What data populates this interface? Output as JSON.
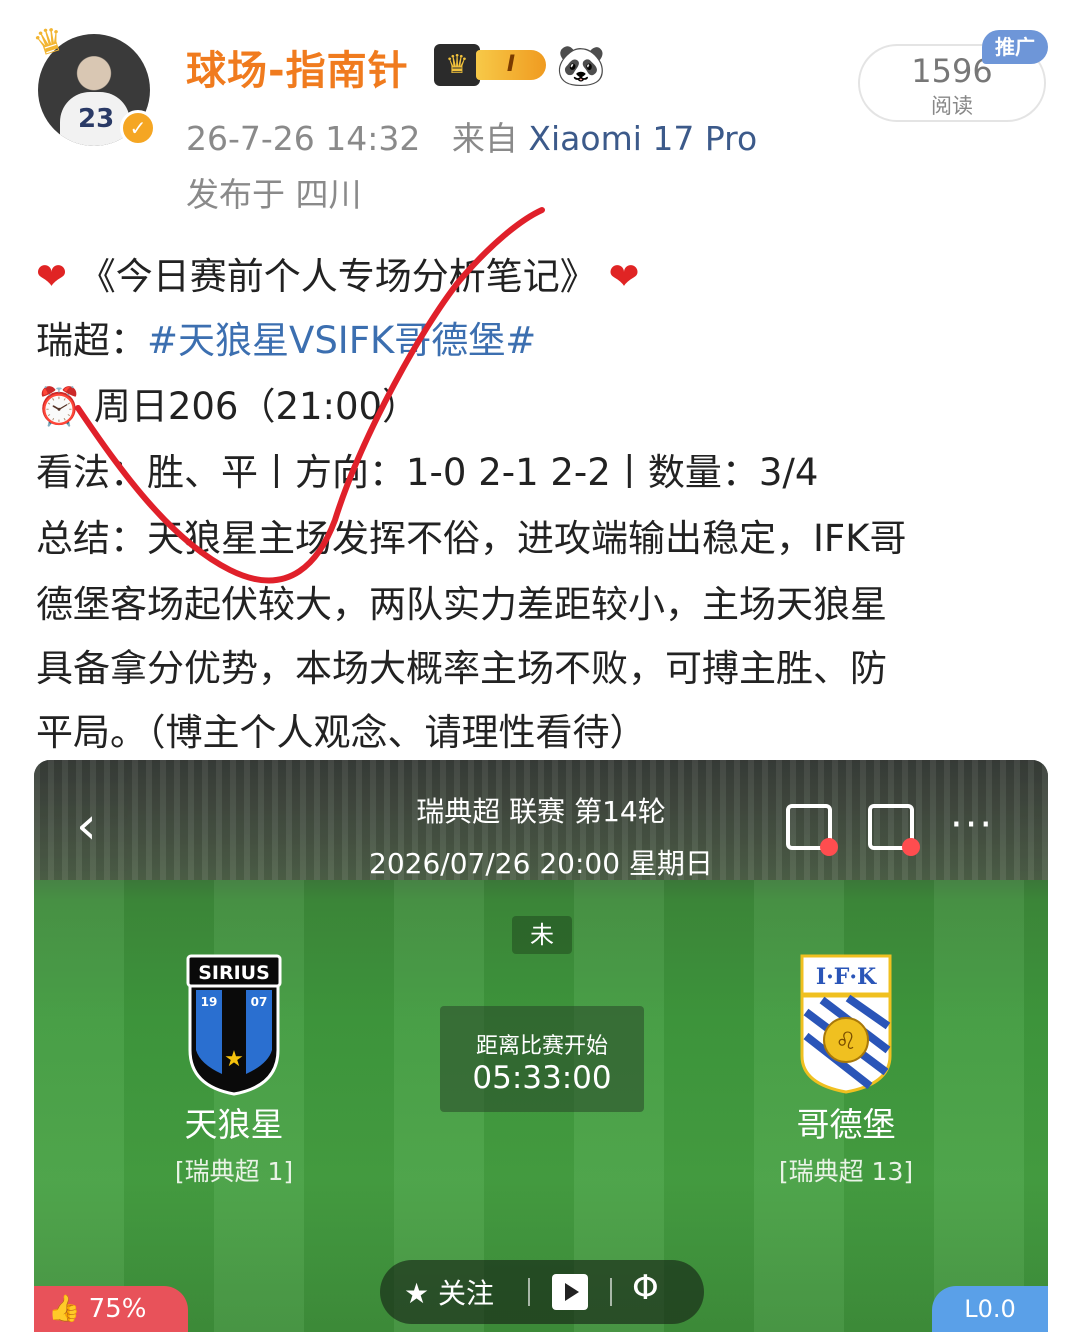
{
  "header": {
    "username": "球场-指南针",
    "level": "I",
    "meta_time": "26-7-26 14:32",
    "meta_from": "来自",
    "meta_device": "Xiaomi 17 Pro",
    "location": "发布于 四川",
    "read_count": "1596",
    "read_label": "阅读",
    "promo_tag": "推广"
  },
  "post": {
    "title": "《今日赛前个人专场分析笔记》",
    "league_prefix": "瑞超：",
    "hashtag": "#天狼星VSIFK哥德堡#",
    "schedule": "周日206（21:00）",
    "view": "看法：胜、平丨方向：1-0 2-1 2-2丨数量：3/4",
    "summary_1": "总结：天狼星主场发挥不俗，进攻端输出稳定，IFK哥",
    "summary_2": "德堡客场起伏较大，两队实力差距较小，主场天狼星",
    "summary_3": "具备拿分优势，本场大概率主场不败，可搏主胜、防",
    "summary_4": "平局。（博主个人观念、请理性看待）"
  },
  "match": {
    "league_round": "瑞典超 联赛 第14轮",
    "datetime": "2026/07/26 20:00 星期日",
    "status": "未",
    "home": {
      "name": "天狼星",
      "rank": "[瑞典超 1]",
      "crest_text": "SIRIUS",
      "crest_year_left": "19",
      "crest_year_right": "07"
    },
    "away": {
      "name": "哥德堡",
      "rank": "[瑞典超 13]",
      "crest_text": "I·F·K"
    },
    "countdown_label": "距离比赛开始",
    "countdown_time": "05:33:00",
    "follow_label": "关注",
    "like_percent": "75%",
    "corner_text": "L0.0"
  },
  "icons": {
    "back": "chevron-left-icon",
    "more": "more-dots-icon",
    "star": "star-icon",
    "play": "play-icon",
    "phi": "phi-icon"
  },
  "colors": {
    "username": "#f07b1e",
    "hashtag": "#3c6fb0",
    "heart": "#e02424",
    "pitch": "#3f9a3d"
  }
}
